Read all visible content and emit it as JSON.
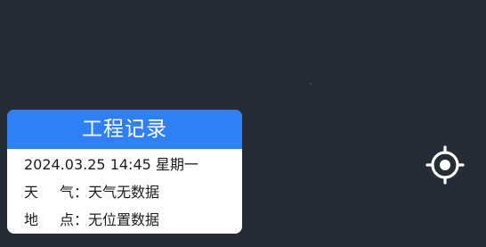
{
  "record_card": {
    "title": "工程记录",
    "datetime": "2024.03.25 14:45 星期一",
    "weather": {
      "label_char1": "天",
      "label_char2": "气",
      "separator": "：",
      "value": "天气无数据"
    },
    "location": {
      "label_char1": "地",
      "label_char2": "点",
      "separator": "：",
      "value": "无位置数据"
    }
  },
  "locate_button": {
    "icon": "crosshair-locate-icon"
  },
  "colors": {
    "background": "#262c34",
    "header": "#2f7ff8",
    "card": "#ffffff",
    "text": "#1c1c1c",
    "icon": "#ffffff"
  }
}
